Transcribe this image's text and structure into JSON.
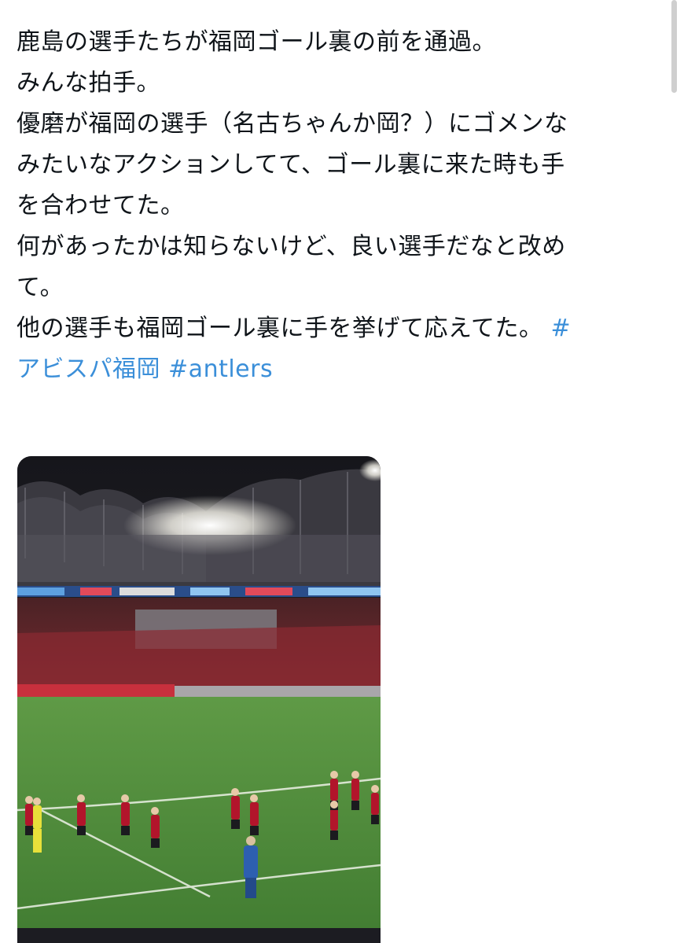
{
  "tweet": {
    "lines": [
      "鹿島の選手たちが福岡ゴール裏の前を通過。",
      "みんな拍手。",
      "優磨が福岡の選手（名古ちゃんか岡？）にゴメンな",
      "みたいなアクションしてて、ゴール裏に来た時も手",
      "を合わせてた。",
      "何があったかは知らないけど、良い選手だなと改め",
      "て。",
      "他の選手も福岡ゴール裏に手を挙げて応えてた。"
    ],
    "hashtag_1_prefix": "#",
    "hashtag_1_name": "アビスパ福岡",
    "hashtag_2": "#antlers"
  },
  "colors": {
    "hashtag": "#3b8fd9",
    "text": "#0f1419",
    "pitch": "#4e8a3a",
    "kit": "#b2152b"
  }
}
